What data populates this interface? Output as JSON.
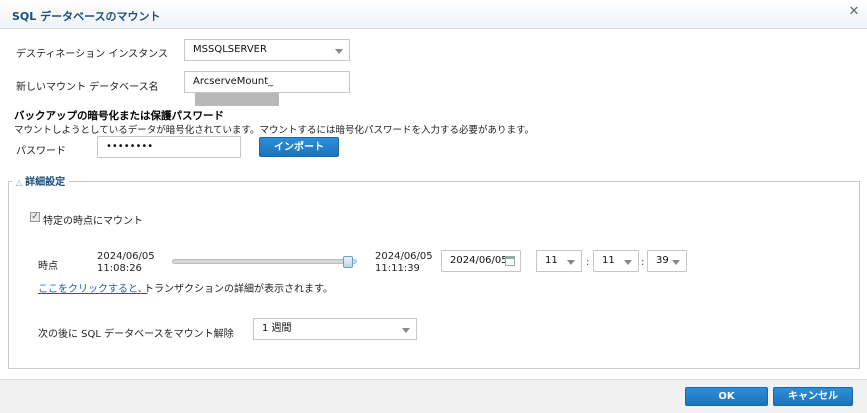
{
  "dialog": {
    "title": "SQL データベースのマウント",
    "close_glyph": "✕"
  },
  "destination": {
    "label": "デスティネーション インスタンス",
    "value": "MSSQLSERVER"
  },
  "mount_name": {
    "label": "新しいマウント データベース名",
    "value": "ArcserveMount_"
  },
  "encryption": {
    "heading": "バックアップの暗号化または保護パスワード",
    "description": "マウントしようとしているデータが暗号化されています。マウントするには暗号化パスワードを入力する必要があります。",
    "password_label": "パスワード",
    "password_value": "••••••••",
    "import_button": "インポート"
  },
  "advanced": {
    "legend": "詳細設定",
    "mount_point_checkbox_label": "特定の時点にマウント",
    "checked": true,
    "time_label": "時点",
    "range_start_date": "2024/06/05",
    "range_start_time": "11:08:26",
    "range_end_date": "2024/06/05",
    "range_end_time": "11:11:39",
    "slider_position": 0.95,
    "date_value": "2024/06/05",
    "hour": "11",
    "minute": "11",
    "second": "39",
    "colon": ":",
    "link_text": "ここをクリックすると、",
    "link_suffix": "トランザクションの詳細が表示されます。",
    "unmount_label": "次の後に SQL データベースをマウント解除",
    "unmount_value": "1 週間"
  },
  "footer": {
    "ok_label": "OK",
    "cancel_label": "キャンセル"
  },
  "icons": [
    "close-icon",
    "chevron-down-icon",
    "calendar-icon",
    "collapse-triangle-icon",
    "checkmark-icon"
  ],
  "colors": {
    "accent": "#1b74bd",
    "title": "#1f4e79",
    "link": "#1a5fb4"
  }
}
